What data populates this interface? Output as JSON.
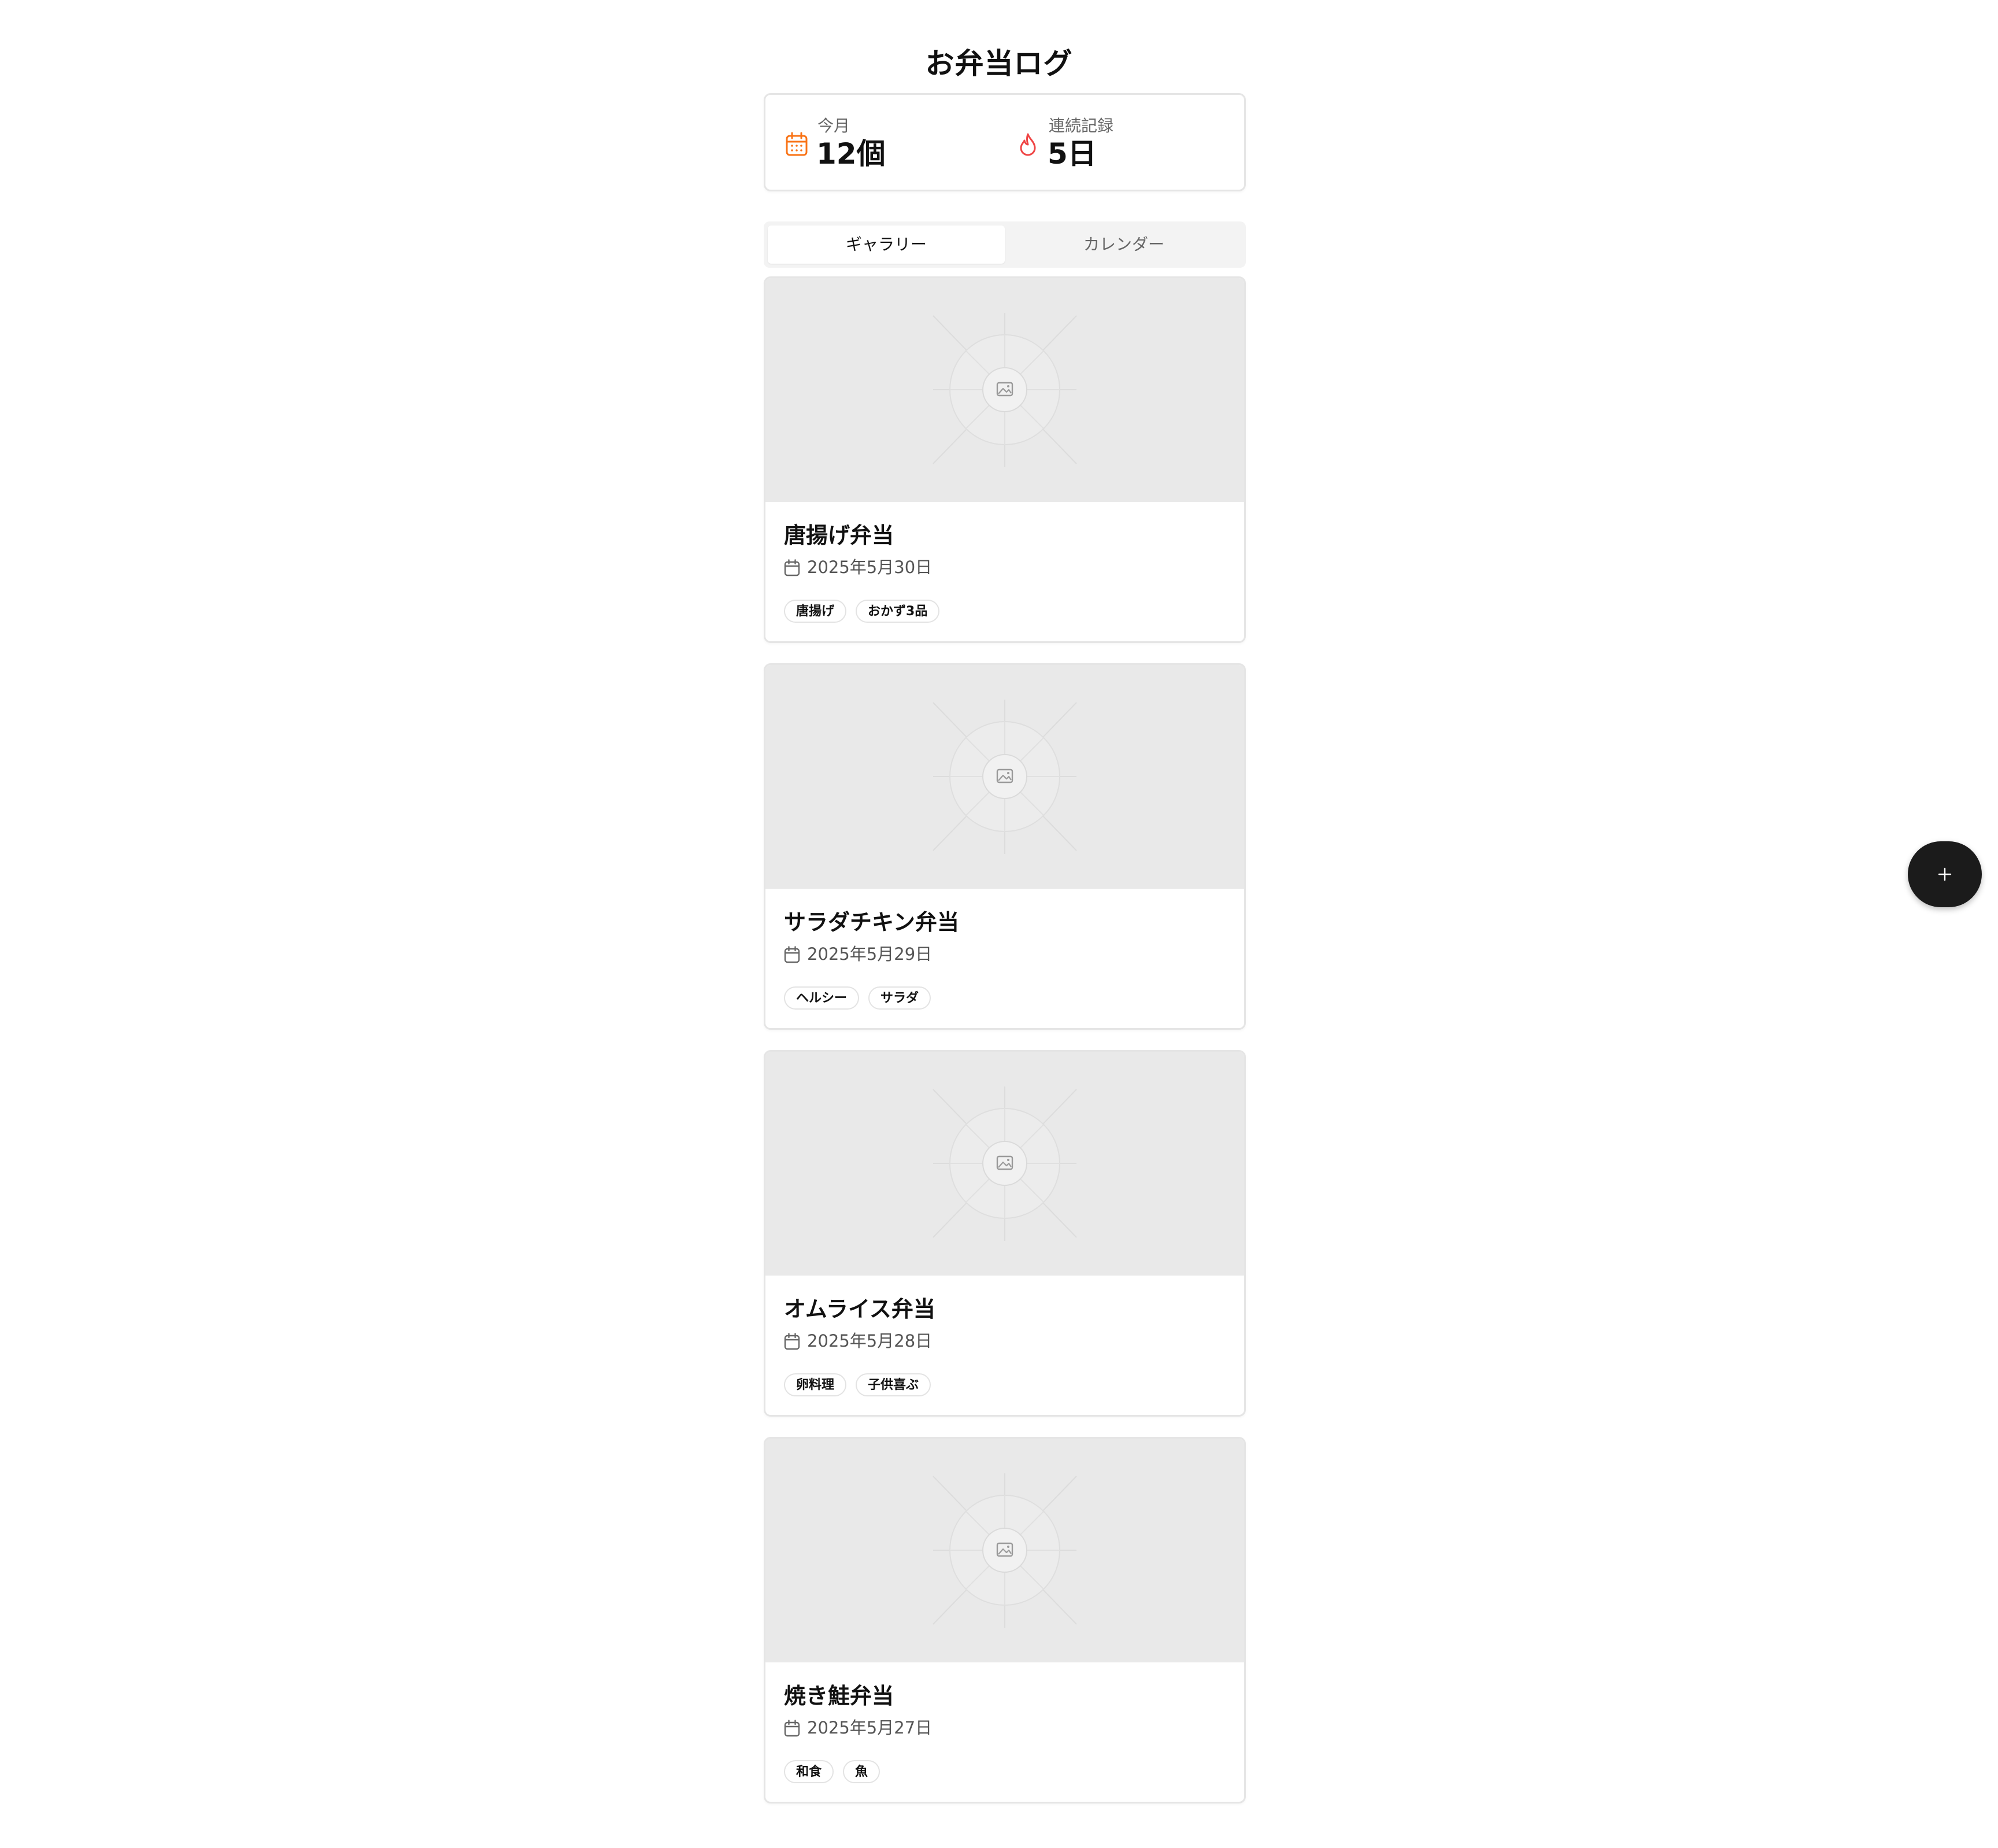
{
  "app": {
    "title": "お弁当ログ"
  },
  "stats": {
    "month": {
      "label": "今月",
      "value": "12個",
      "icon": "calendar-icon",
      "color": "#f97316"
    },
    "streak": {
      "label": "連続記録",
      "value": "5日",
      "icon": "flame-icon",
      "color": "#ef4444"
    }
  },
  "tabs": [
    {
      "label": "ギャラリー",
      "active": true
    },
    {
      "label": "カレンダー",
      "active": false
    }
  ],
  "entries": [
    {
      "title": "唐揚げ弁当",
      "date": "2025年5月30日",
      "tags": [
        "唐揚げ",
        "おかず3品"
      ],
      "image": "image-placeholder-icon"
    },
    {
      "title": "サラダチキン弁当",
      "date": "2025年5月29日",
      "tags": [
        "ヘルシー",
        "サラダ"
      ],
      "image": "image-placeholder-icon"
    },
    {
      "title": "オムライス弁当",
      "date": "2025年5月28日",
      "tags": [
        "卵料理",
        "子供喜ぶ"
      ],
      "image": "image-placeholder-icon"
    },
    {
      "title": "焼き鮭弁当",
      "date": "2025年5月27日",
      "tags": [
        "和食",
        "魚"
      ],
      "image": "image-placeholder-icon"
    }
  ],
  "fab": {
    "icon": "plus-icon"
  }
}
